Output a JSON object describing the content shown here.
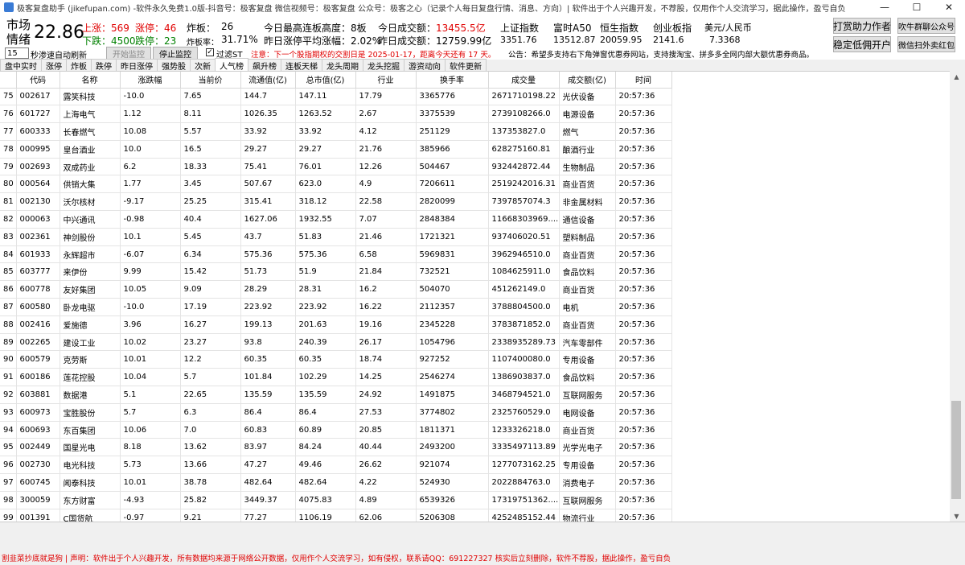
{
  "window": {
    "title": "极客复盘助手 (jikefupan.com) -软件永久免费1.0版-抖音号：极客复盘 微信视频号：极客复盘 公众号：极客之心（记录个人每日复盘行情、消息、方向）| 软件出于个人兴趣开发，不荐股，仅用作个人交流学习，据此操作，盈亏自负",
    "minimize": "—",
    "maximize": "☐",
    "close": "✕"
  },
  "market": {
    "label_line1": "市场",
    "label_line2": "情绪",
    "score": "22.86",
    "up_label": "上涨：",
    "up_value": "569",
    "limit_up_label": "涨停：",
    "limit_up_value": "46",
    "down_label": "下跌：",
    "down_value": "4500",
    "limit_down_label": "跌停：",
    "limit_down_value": "23",
    "blowup_label": "炸板：",
    "blowup_value": "26",
    "blowup_rate_label": "炸板率：",
    "blowup_rate_value": "31.71%",
    "max_chain_label": "今日最高连板高度：",
    "max_chain_value": "8板",
    "avg_gain_label": "昨日涨停平均涨幅：",
    "avg_gain_value": "2.02%",
    "today_turnover_label": "今日成交额：",
    "today_turnover_value": "13455.5亿",
    "yesterday_turnover_label": "昨日成交额：",
    "yesterday_turnover_value": "12759.99亿"
  },
  "indices": [
    {
      "name": "上证指数",
      "value": "3351.76",
      "color": "#008000"
    },
    {
      "name": "富时A50",
      "value": "13512.87",
      "color": "#008000"
    },
    {
      "name": "恒生指数",
      "value": "20059.95",
      "color": "#e00000"
    },
    {
      "name": "创业板指",
      "value": "2141.6",
      "color": "#008000"
    },
    {
      "name": "美元/人民币",
      "value": "7.3368",
      "color": "#e00000"
    }
  ],
  "buttons": {
    "tip_author": "打赏助力作者",
    "stable_account": "稳定低佣开户",
    "join_group": "吹牛群聊公众号",
    "wechat_red": "微信扫外卖红包",
    "start_monitor": "开始监控",
    "stop_monitor": "停止监控"
  },
  "controls": {
    "refresh_seconds": "15",
    "refresh_label": "秒渗速自动刷新",
    "filter_st_label": "过滤ST",
    "filter_st_checked": true,
    "notice": "注意：下一个股指期权的交割日是 2025-01-17，距离今天还有 17 天。",
    "announcement": "公告：希望多支持右下角弹窗优惠券网站，支持搜淘宝、拼多多全网内部大额优惠券商品。"
  },
  "tabs": [
    "盘中实时",
    "涨停",
    "炸板",
    "跌停",
    "昨日涨停",
    "强势股",
    "次新",
    "人气榜",
    "飙升榜",
    "连板天梯",
    "龙头周期",
    "龙头挖掘",
    "游资动向",
    "软件更新"
  ],
  "active_tab": 7,
  "table": {
    "headers": [
      "代码",
      "名称",
      "涨跌幅",
      "当前价",
      "流通值(亿)",
      "总市值(亿)",
      "行业",
      "换手率",
      "成交量",
      "成交额(亿)",
      "时间"
    ],
    "rows": [
      [
        "75",
        "002617",
        "露笑科技",
        "-10.0",
        "7.65",
        "144.7",
        "147.11",
        "17.79",
        "3365776",
        "2671710198.22",
        "光伏设备",
        "20:57:36"
      ],
      [
        "76",
        "601727",
        "上海电气",
        "1.12",
        "8.11",
        "1026.35",
        "1263.52",
        "2.67",
        "3375539",
        "2739108266.0",
        "电源设备",
        "20:57:36"
      ],
      [
        "77",
        "600333",
        "长春燃气",
        "10.08",
        "5.57",
        "33.92",
        "33.92",
        "4.12",
        "251129",
        "137353827.0",
        "燃气",
        "20:57:36"
      ],
      [
        "78",
        "000995",
        "皇台酒业",
        "10.0",
        "16.5",
        "29.27",
        "29.27",
        "21.76",
        "385966",
        "628275160.81",
        "酿酒行业",
        "20:57:36"
      ],
      [
        "79",
        "002693",
        "双成药业",
        "6.2",
        "18.33",
        "75.41",
        "76.01",
        "12.26",
        "504467",
        "932442872.44",
        "生物制品",
        "20:57:36"
      ],
      [
        "80",
        "000564",
        "供销大集",
        "1.77",
        "3.45",
        "507.67",
        "623.0",
        "4.9",
        "7206611",
        "2519242016.31",
        "商业百货",
        "20:57:36"
      ],
      [
        "81",
        "002130",
        "沃尔核材",
        "-9.17",
        "25.25",
        "315.41",
        "318.12",
        "22.58",
        "2820099",
        "7397857074.3",
        "非金属材料",
        "20:57:36"
      ],
      [
        "82",
        "000063",
        "中兴通讯",
        "-0.98",
        "40.4",
        "1627.06",
        "1932.55",
        "7.07",
        "2848384",
        "11668303969....",
        "通信设备",
        "20:57:36"
      ],
      [
        "83",
        "002361",
        "神剑股份",
        "10.1",
        "5.45",
        "43.7",
        "51.83",
        "21.46",
        "1721321",
        "937406020.51",
        "塑料制品",
        "20:57:36"
      ],
      [
        "84",
        "601933",
        "永辉超市",
        "-6.07",
        "6.34",
        "575.36",
        "575.36",
        "6.58",
        "5969831",
        "3962946510.0",
        "商业百货",
        "20:57:36"
      ],
      [
        "85",
        "603777",
        "来伊份",
        "9.99",
        "15.42",
        "51.73",
        "51.9",
        "21.84",
        "732521",
        "1084625911.0",
        "食品饮料",
        "20:57:36"
      ],
      [
        "86",
        "600778",
        "友好集团",
        "10.05",
        "9.09",
        "28.29",
        "28.31",
        "16.2",
        "504070",
        "451262149.0",
        "商业百货",
        "20:57:36"
      ],
      [
        "87",
        "600580",
        "卧龙电驱",
        "-10.0",
        "17.19",
        "223.92",
        "223.92",
        "16.22",
        "2112357",
        "3788804500.0",
        "电机",
        "20:57:36"
      ],
      [
        "88",
        "002416",
        "爱施德",
        "3.96",
        "16.27",
        "199.13",
        "201.63",
        "19.16",
        "2345228",
        "3783871852.0",
        "商业百货",
        "20:57:36"
      ],
      [
        "89",
        "002265",
        "建设工业",
        "10.02",
        "23.27",
        "93.8",
        "240.39",
        "26.17",
        "1054796",
        "2338935289.73",
        "汽车零部件",
        "20:57:36"
      ],
      [
        "90",
        "600579",
        "克劳斯",
        "10.01",
        "12.2",
        "60.35",
        "60.35",
        "18.74",
        "927252",
        "1107400080.0",
        "专用设备",
        "20:57:36"
      ],
      [
        "91",
        "600186",
        "莲花控股",
        "10.04",
        "5.7",
        "101.84",
        "102.29",
        "14.25",
        "2546274",
        "1386903837.0",
        "食品饮料",
        "20:57:36"
      ],
      [
        "92",
        "603881",
        "数据港",
        "5.1",
        "22.65",
        "135.59",
        "135.59",
        "24.92",
        "1491875",
        "3468794521.0",
        "互联网服务",
        "20:57:36"
      ],
      [
        "93",
        "600973",
        "宝胜股份",
        "5.7",
        "6.3",
        "86.4",
        "86.4",
        "27.53",
        "3774802",
        "2325760529.0",
        "电网设备",
        "20:57:36"
      ],
      [
        "94",
        "600693",
        "东百集团",
        "10.06",
        "7.0",
        "60.83",
        "60.89",
        "20.85",
        "1811371",
        "1233326218.0",
        "商业百货",
        "20:57:36"
      ],
      [
        "95",
        "002449",
        "国星光电",
        "8.18",
        "13.62",
        "83.97",
        "84.24",
        "40.44",
        "2493200",
        "3335497113.89",
        "光学光电子",
        "20:57:36"
      ],
      [
        "96",
        "002730",
        "电光科技",
        "5.73",
        "13.66",
        "47.27",
        "49.46",
        "26.62",
        "921074",
        "1277073162.25",
        "专用设备",
        "20:57:36"
      ],
      [
        "97",
        "600745",
        "闻泰科技",
        "10.01",
        "38.78",
        "482.64",
        "482.64",
        "4.22",
        "524930",
        "2022884763.0",
        "消费电子",
        "20:57:36"
      ],
      [
        "98",
        "300059",
        "东方财富",
        "-4.93",
        "25.82",
        "3449.37",
        "4075.83",
        "4.89",
        "6539326",
        "17319751362....",
        "互联网服务",
        "20:57:36"
      ],
      [
        "99",
        "001391",
        "C国货航",
        "-0.97",
        "9.21",
        "77.27",
        "1106.19",
        "62.06",
        "5206308",
        "4252485152.44",
        "物流行业",
        "20:57:36"
      ]
    ]
  },
  "statusbar": "割韭菜抄底就是狗 | 声明：软件出于个人兴趣开发，所有数据均来源于网络公开数据，仅用作个人交流学习，如有侵权，联系请QQ：691227327 核实后立刻删除，软件不荐股，据此操作，盈亏自负"
}
